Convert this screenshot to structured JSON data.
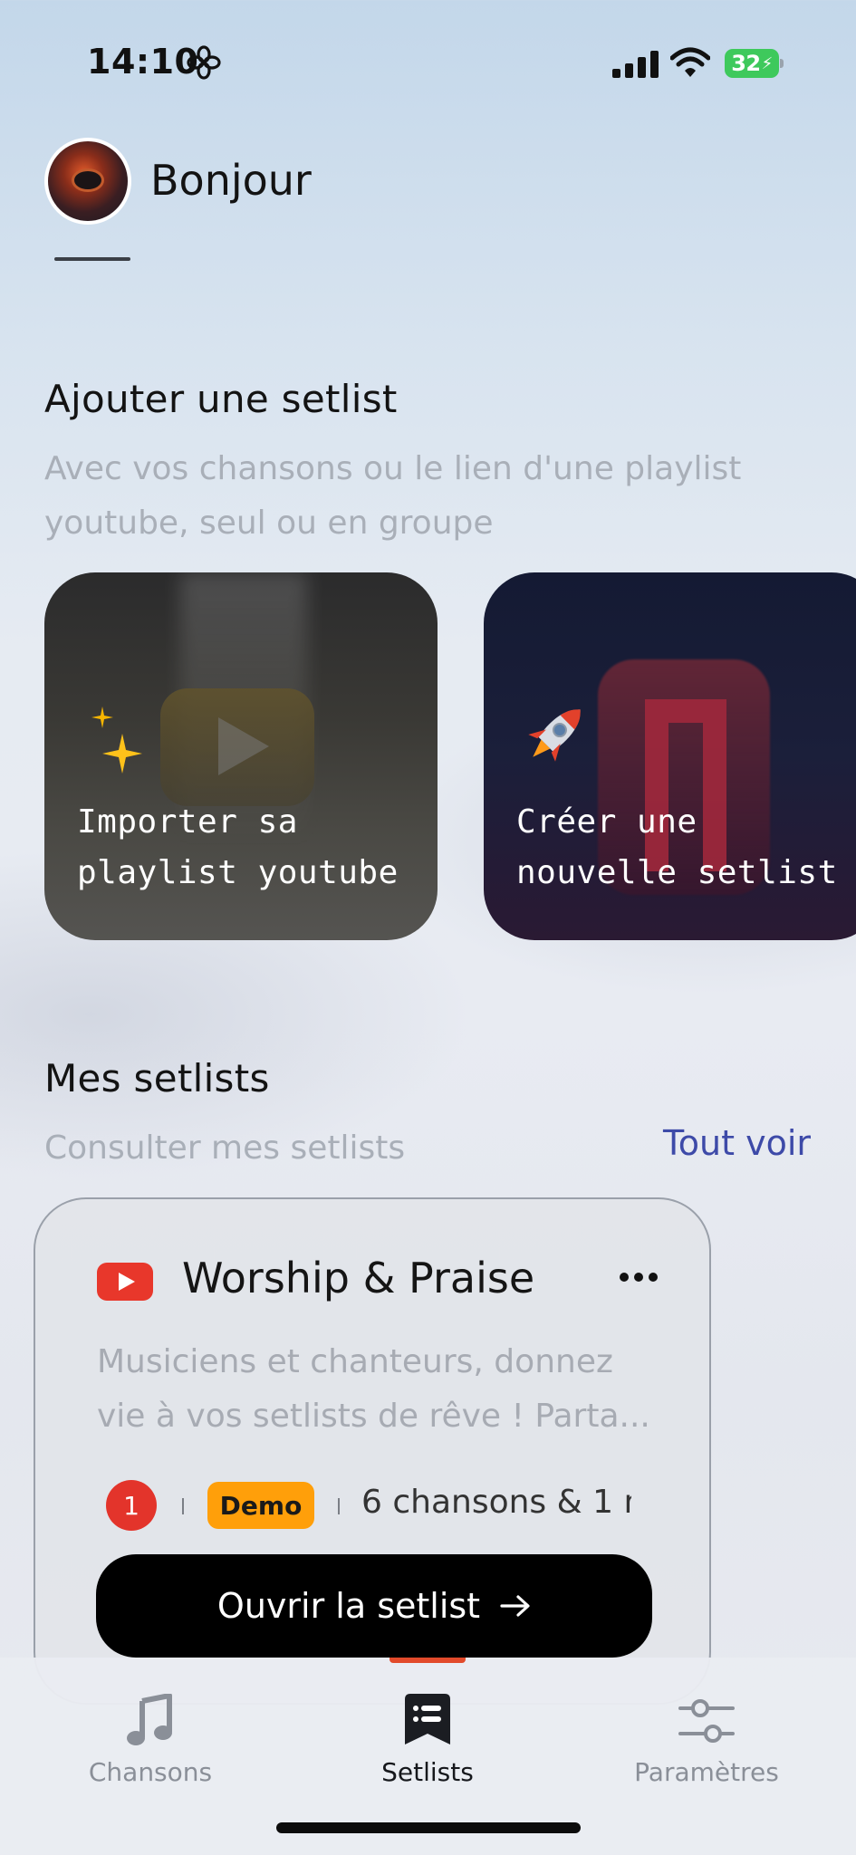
{
  "status_bar": {
    "time": "14:10",
    "battery_level": "32",
    "battery_color": "#3ec95c"
  },
  "header": {
    "greeting": "Bonjour"
  },
  "add_section": {
    "title": "Ajouter une setlist",
    "subtitle": "Avec vos chansons ou le lien d'une playlist youtube, seul ou en groupe",
    "cards": [
      {
        "label": "Importer sa playlist youtube",
        "icon": "sparkles-icon"
      },
      {
        "label": "Créer une nouvelle setlist",
        "icon": "rocket-icon"
      }
    ]
  },
  "my_setlists": {
    "title": "Mes setlists",
    "subtitle": "Consulter mes setlists",
    "see_all": "Tout voir",
    "items": [
      {
        "name": "Worship & Praise",
        "source_icon": "youtube-icon",
        "description": "Musiciens et chanteurs, donnez vie à vos setlists de rêve ! Parta...",
        "member_count": "1",
        "badge": "Demo",
        "songs": "6 chansons & 1 m",
        "open_label": "Ouvrir la setlist"
      }
    ]
  },
  "tab_bar": {
    "active": "Setlists",
    "accent": "#e24a2b",
    "tabs": [
      {
        "label": "Chansons",
        "icon": "music-note-icon"
      },
      {
        "label": "Setlists",
        "icon": "list-icon"
      },
      {
        "label": "Paramètres",
        "icon": "sliders-icon"
      }
    ]
  }
}
